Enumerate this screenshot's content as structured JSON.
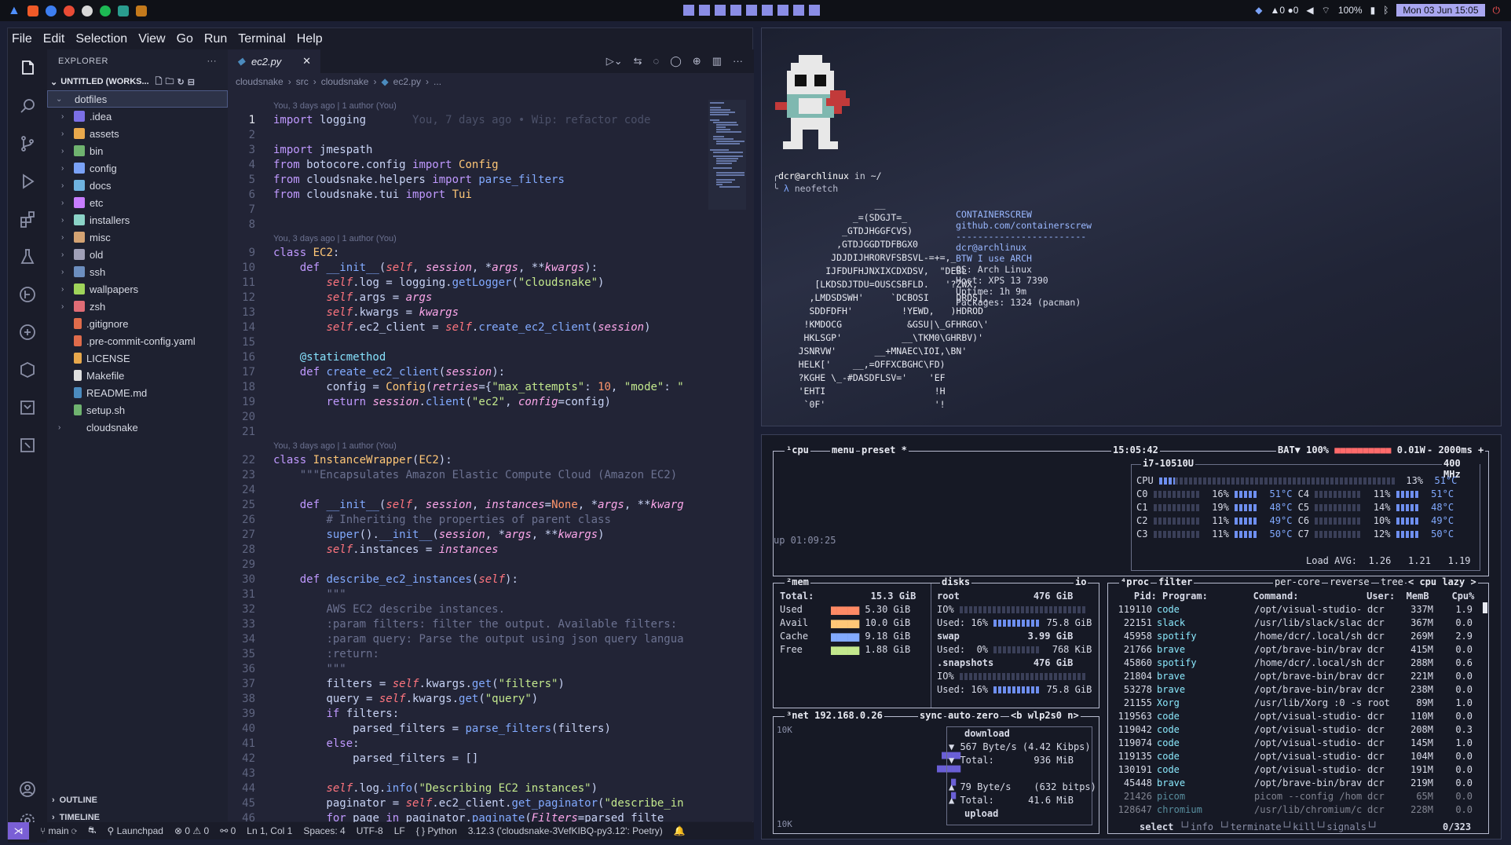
{
  "topbar": {
    "battery": "100%",
    "datetime": "Mon 03 Jun 15:05",
    "notif_a": "0",
    "notif_b": "0",
    "ws": [
      "",
      "",
      "",
      "",
      "",
      "",
      "",
      "",
      "",
      ""
    ]
  },
  "menu": [
    "File",
    "Edit",
    "Selection",
    "View",
    "Go",
    "Run",
    "Terminal",
    "Help"
  ],
  "explorer": {
    "title": "EXPLORER",
    "workspace": "UNTITLED (WORKS...",
    "root": "dotfiles",
    "folders": [
      ".idea",
      "assets",
      "bin",
      "config",
      "docs",
      "etc",
      "installers",
      "misc",
      "old",
      "ssh",
      "wallpapers",
      "zsh"
    ],
    "files": [
      ".gitignore",
      ".pre-commit-config.yaml",
      "LICENSE",
      "Makefile",
      "README.md",
      "setup.sh"
    ],
    "other": "cloudsnake",
    "outline": "OUTLINE",
    "timeline": "TIMELINE"
  },
  "tab": {
    "name": "ec2.py"
  },
  "breadcrumb": [
    "cloudsnake",
    "src",
    "cloudsnake",
    "ec2.py",
    "..."
  ],
  "blame": {
    "l1": "You, 3 days ago | 1 author (You)",
    "ghost": "You, 7 days ago • Wip: refactor code"
  },
  "status": {
    "branch": "main",
    "launchpad": "Launchpad",
    "errors": "0",
    "warnings": "0",
    "ports": "0",
    "pos": "Ln 1, Col 1",
    "spaces": "Spaces: 4",
    "enc": "UTF-8",
    "eol": "LF",
    "lang": "Python",
    "interp": "3.12.3 ('cloudsnake-3VefKIBQ-py3.12': Poetry)"
  },
  "neofetch": {
    "user": "dcr@archlinux",
    "in": "in",
    "dir": "~/",
    "cmd": "neofetch",
    "info": [
      "CONTAINERSCREW",
      "github.com/containerscrew",
      "------------------------",
      "dcr@archlinux",
      "BTW I use ARCH",
      "OS: Arch Linux",
      "Host: XPS 13 7390",
      "Uptime: 1h 9m",
      "Packages: 1324 (pacman)"
    ]
  },
  "btop": {
    "time": "15:05:42",
    "bat": "BAT▼ 100%",
    "power": "0.01W",
    "interval": "2000ms",
    "cpu_model": "i7-10510U",
    "freq": "400 MHz",
    "uptime": "up 01:09:25",
    "load": "Load AVG:  1.26   1.21   1.19",
    "cpu_total": "13%",
    "cpu_temp": "51°C",
    "cores": [
      [
        "C0",
        "16%",
        "51°C",
        "C4",
        "11%",
        "51°C"
      ],
      [
        "C1",
        "19%",
        "48°C",
        "C5",
        "14%",
        "48°C"
      ],
      [
        "C2",
        "11%",
        "49°C",
        "C6",
        "10%",
        "49°C"
      ],
      [
        "C3",
        "11%",
        "50°C",
        "C7",
        "12%",
        "50°C"
      ]
    ],
    "mem": {
      "total": "15.3 GiB",
      "used": "5.30 GiB",
      "avail": "10.0 GiB",
      "cache": "9.18 GiB",
      "free": "1.88 GiB"
    },
    "disks": {
      "root": "476 GiB",
      "root_used": "Used: 16%",
      "root_size": "75.8 GiB",
      "swap": "3.99 GiB",
      "swap_used": "Used:  0%",
      "swap_size": "768 KiB",
      "snap": "476 GiB",
      "snap_used": "Used: 16%",
      "snap_size": "75.8 GiB"
    },
    "net": {
      "ip": "192.168.0.26",
      "iface": "wlp2s0",
      "down": "567 Byte/s (4.42 Kibps)",
      "down_total": "936 MiB",
      "up": "79 Byte/s",
      "up_bits": "(632 bitps)",
      "up_total": "41.6 MiB",
      "scale": "10K"
    },
    "procs": [
      [
        "119110",
        "code",
        "/opt/visual-studio-",
        "dcr",
        "337M",
        "1.9"
      ],
      [
        "22151",
        "slack",
        "/usr/lib/slack/slac",
        "dcr",
        "367M",
        "0.0"
      ],
      [
        "45958",
        "spotify",
        "/home/dcr/.local/sh",
        "dcr",
        "269M",
        "2.9"
      ],
      [
        "21766",
        "brave",
        "/opt/brave-bin/brav",
        "dcr",
        "415M",
        "0.0"
      ],
      [
        "45860",
        "spotify",
        "/home/dcr/.local/sh",
        "dcr",
        "288M",
        "0.6"
      ],
      [
        "21804",
        "brave",
        "/opt/brave-bin/brav",
        "dcr",
        "221M",
        "0.0"
      ],
      [
        "53278",
        "brave",
        "/opt/brave-bin/brav",
        "dcr",
        "238M",
        "0.0"
      ],
      [
        "21155",
        "Xorg",
        "/usr/lib/Xorg :0 -s",
        "root",
        "89M",
        "1.0"
      ],
      [
        "119563",
        "code",
        "/opt/visual-studio-",
        "dcr",
        "110M",
        "0.0"
      ],
      [
        "119042",
        "code",
        "/opt/visual-studio-",
        "dcr",
        "208M",
        "0.3"
      ],
      [
        "119074",
        "code",
        "/opt/visual-studio-",
        "dcr",
        "145M",
        "1.0"
      ],
      [
        "119135",
        "code",
        "/opt/visual-studio-",
        "dcr",
        "104M",
        "0.0"
      ],
      [
        "130191",
        "code",
        "/opt/visual-studio-",
        "dcr",
        "191M",
        "0.0"
      ],
      [
        "45448",
        "brave",
        "/opt/brave-bin/brav",
        "dcr",
        "219M",
        "0.0"
      ],
      [
        "21426",
        "picom",
        "picom --config /hom",
        "dcr",
        "65M",
        "0.0"
      ],
      [
        "128647",
        "chromium",
        "/usr/lib/chromium/c",
        "dcr",
        "228M",
        "0.0"
      ]
    ],
    "proc_count": "0/323"
  }
}
